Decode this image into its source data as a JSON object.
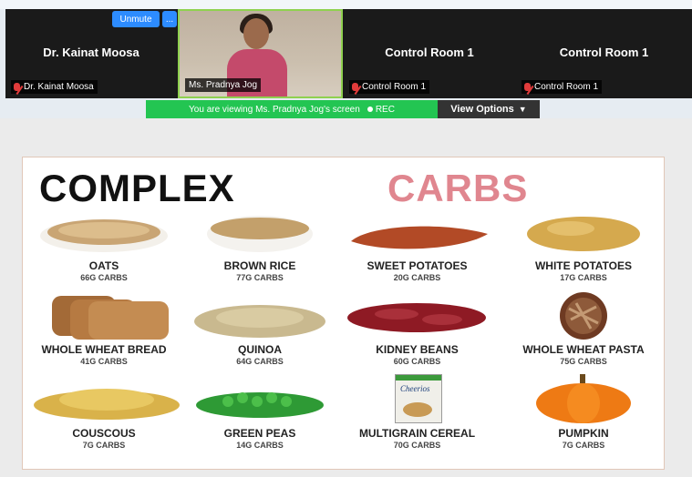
{
  "meeting": {
    "participants": [
      {
        "name": "Dr. Kainat Moosa",
        "label": "Dr. Kainat Moosa",
        "muted": true
      },
      {
        "name": "",
        "label": "Ms. Pradnya Jog",
        "muted": false,
        "video": true
      },
      {
        "name": "Control Room 1",
        "label": "Control Room 1",
        "muted": true
      },
      {
        "name": "Control Room 1",
        "label": "Control Room 1",
        "muted": true
      }
    ],
    "unmute_label": "Unmute",
    "more_label": "...",
    "share_banner_prefix": "You are viewing",
    "share_banner_name": "Ms. Pradnya Jog's screen",
    "rec_label": "REC",
    "view_options_label": "View Options",
    "colors": {
      "accent": "#2d8cff",
      "share_green": "#23c552",
      "active_border": "#8fd14f",
      "muted_red": "#e03b3b"
    }
  },
  "poster": {
    "title_part1": "COMPLEX",
    "title_part2": "CARBS",
    "title_colors": {
      "part1": "#111111",
      "part2": "#e0868f"
    },
    "items": [
      {
        "name": "OATS",
        "carbs": "66G CARBS"
      },
      {
        "name": "BROWN RICE",
        "carbs": "77G CARBS"
      },
      {
        "name": "SWEET POTATOES",
        "carbs": "20G CARBS"
      },
      {
        "name": "WHITE POTATOES",
        "carbs": "17G CARBS"
      },
      {
        "name": "WHOLE WHEAT BREAD",
        "carbs": "41G CARBS"
      },
      {
        "name": "QUINOA",
        "carbs": "64G CARBS"
      },
      {
        "name": "KIDNEY BEANS",
        "carbs": "60G CARBS"
      },
      {
        "name": "WHOLE WHEAT PASTA",
        "carbs": "75G CARBS"
      },
      {
        "name": "COUSCOUS",
        "carbs": "7G CARBS"
      },
      {
        "name": "GREEN PEAS",
        "carbs": "14G CARBS"
      },
      {
        "name": "MULTIGRAIN CEREAL",
        "carbs": "70G CARBS"
      },
      {
        "name": "PUMPKIN",
        "carbs": "7G CARBS"
      }
    ],
    "cereal_brand": "Cheerios"
  }
}
